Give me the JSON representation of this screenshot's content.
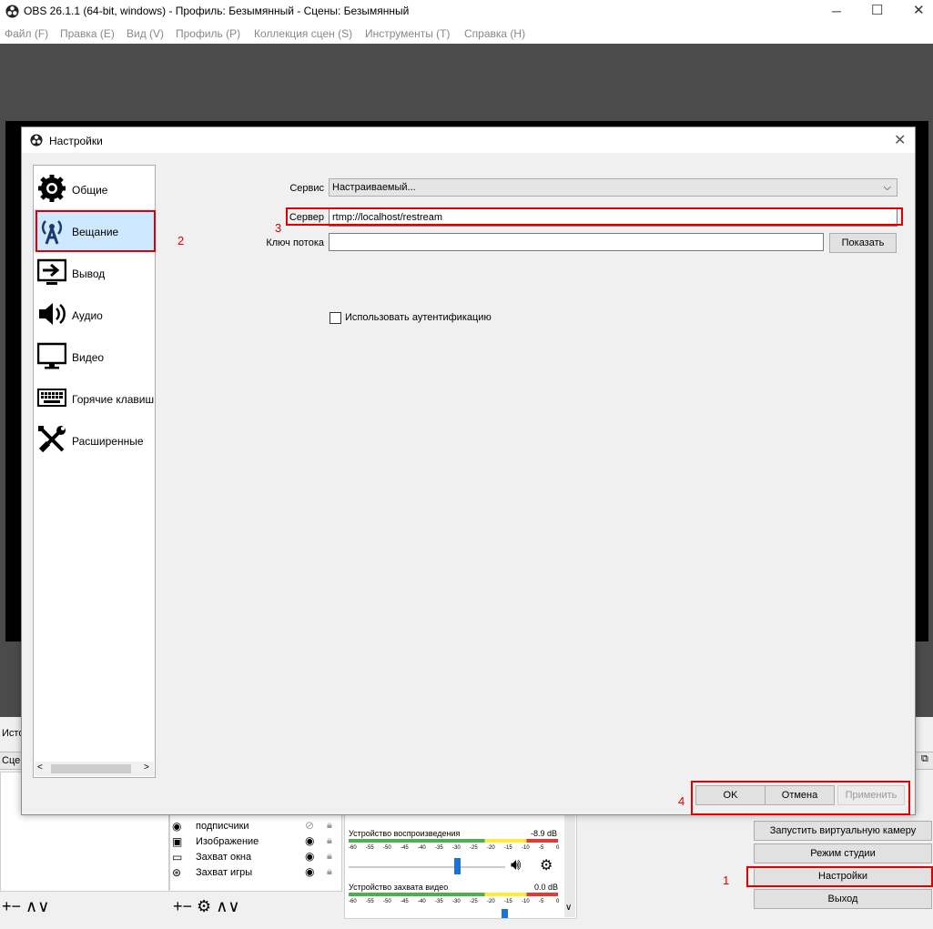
{
  "window": {
    "title": "OBS 26.1.1 (64-bit, windows) - Профиль: Безымянный - Сцены: Безымянный"
  },
  "menu": [
    "Файл (F)",
    "Правка (E)",
    "Вид (V)",
    "Профиль (P)",
    "Коллекция сцен (S)",
    "Инструменты (T)",
    "Справка (H)"
  ],
  "dock_fragments": {
    "sources_title": "Исто",
    "scenes_title": "Сцен"
  },
  "sources": [
    {
      "name": "подписчики",
      "visible": false
    },
    {
      "name": "Изображение",
      "visible": true
    },
    {
      "name": "Захват окна",
      "visible": true
    },
    {
      "name": "Захват игры",
      "visible": true
    }
  ],
  "mixer": {
    "channels": [
      {
        "name": "Устройство воспроизведения",
        "db": "-8.9 dB",
        "fader_pct": 0.69
      },
      {
        "name": "Устройство захвата видео",
        "db": "0.0 dB",
        "fader_pct": 1.0
      }
    ],
    "scale": [
      "-60",
      "-55",
      "-50",
      "-45",
      "-40",
      "-35",
      "-30",
      "-25",
      "-20",
      "-15",
      "-10",
      "-5",
      "0"
    ]
  },
  "controls": {
    "virtual_cam": "Запустить виртуальную камеру",
    "studio_mode": "Режим студии",
    "settings": "Настройки",
    "exit": "Выход"
  },
  "dialog": {
    "title": "Настройки",
    "categories": [
      {
        "label": "Общие",
        "icon": "gear-icon"
      },
      {
        "label": "Вещание",
        "icon": "antenna-icon",
        "selected": true
      },
      {
        "label": "Вывод",
        "icon": "output-icon"
      },
      {
        "label": "Аудио",
        "icon": "speaker-icon"
      },
      {
        "label": "Видео",
        "icon": "monitor-icon"
      },
      {
        "label": "Горячие клавиш",
        "icon": "keyboard-icon"
      },
      {
        "label": "Расширенные",
        "icon": "tools-icon"
      }
    ],
    "service_label": "Сервис",
    "service_value": "Настраиваемый...",
    "server_label": "Сервер",
    "server_value": "rtmp://localhost/restream",
    "key_label": "Ключ потока",
    "key_value": "",
    "show_button": "Показать",
    "auth_checkbox": "Использовать аутентификацию",
    "auth_checked": false,
    "ok": "OK",
    "cancel": "Отмена",
    "apply": "Применить"
  },
  "annotations": [
    "1",
    "2",
    "3",
    "4"
  ],
  "colors": {
    "highlight": "#e00000",
    "selection": "#cde8ff",
    "preview_bg": "#4b4b4b"
  }
}
